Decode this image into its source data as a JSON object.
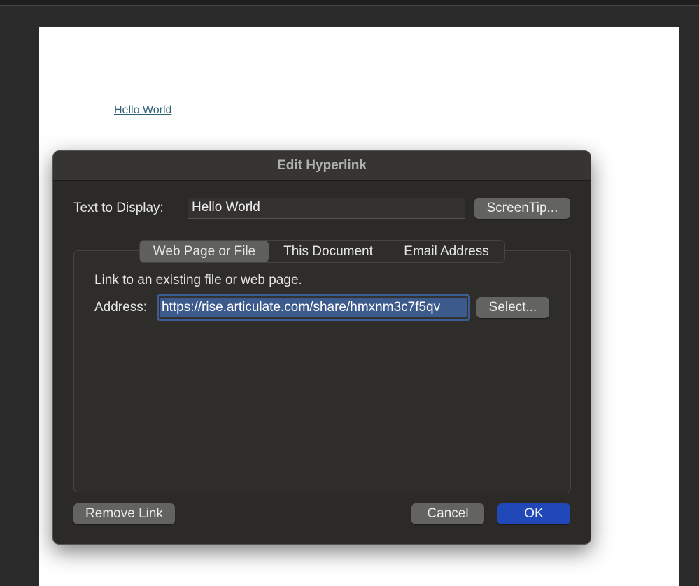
{
  "document": {
    "link_text": "Hello World"
  },
  "dialog": {
    "title": "Edit Hyperlink",
    "text_to_display_label": "Text to Display:",
    "text_to_display_value": "Hello World",
    "screentip_button": "ScreenTip...",
    "tabs": [
      {
        "label": "Web Page or File",
        "active": true
      },
      {
        "label": "This Document"
      },
      {
        "label": "Email Address"
      }
    ],
    "description": "Link to an existing file or web page.",
    "address_label": "Address:",
    "address_value": "https://rise.articulate.com/share/hmxnm3c7f5qv",
    "select_button": "Select...",
    "remove_link_button": "Remove Link",
    "cancel_button": "Cancel",
    "ok_button": "OK"
  },
  "colors": {
    "accent": "#2148b8"
  }
}
